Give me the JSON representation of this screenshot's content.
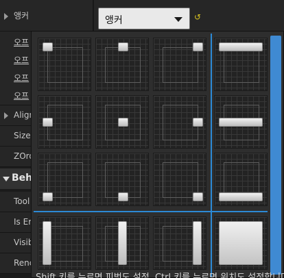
{
  "details": {
    "anchor_label": "앵커",
    "anchor_value": "앵커",
    "offset_rows": [
      "오프",
      "오프",
      "오프",
      "오프"
    ],
    "alignment_label": "Align",
    "size_label": "Size",
    "zorder_label": "ZOrd",
    "behavior_section": "Beh",
    "tooltip_label": "Tool",
    "is_enabled_label": "Is Er",
    "visibility_label": "Visib",
    "render_label": "Renc",
    "reset_glyph": "↺"
  },
  "anchor_popup": {
    "presets": [
      "top-left",
      "top-center",
      "top-right",
      "top-stretch",
      "center-left",
      "center-center",
      "center-right",
      "center-stretch",
      "bottom-left",
      "bottom-center",
      "bottom-right",
      "bottom-stretch",
      "stretch-left",
      "stretch-center",
      "stretch-right",
      "stretch-full"
    ],
    "tooltip_text": "Shift 키를 누르면 피벗도 설정, Ctrl 키를 누르면 위치도 설정합니다"
  },
  "colors": {
    "accent_blue": "#2c8ad6",
    "scrollbar": "#3f8ad2",
    "reset_icon": "#d8c320"
  }
}
